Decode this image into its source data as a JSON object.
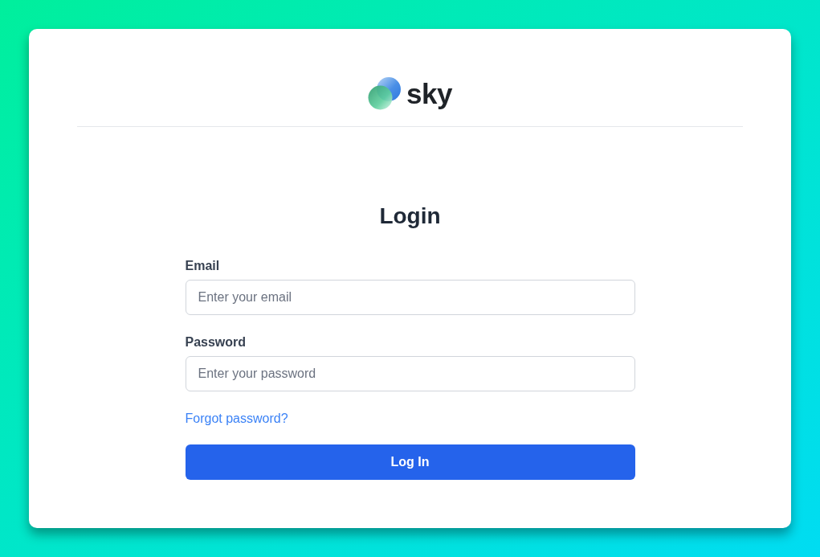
{
  "logo": {
    "text": "sky"
  },
  "heading": "Login",
  "fields": [
    {
      "label": "Email",
      "placeholder": "Enter your email"
    },
    {
      "label": "Password",
      "placeholder": "Enter your password"
    }
  ],
  "forgot_link": "Forgot password?",
  "submit_button": "Log In"
}
